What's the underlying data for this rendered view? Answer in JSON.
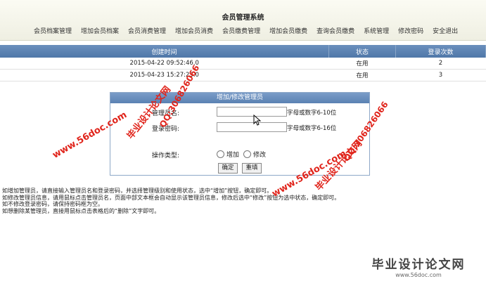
{
  "app": {
    "title": "会员管理系统"
  },
  "nav": [
    "会员档案管理",
    "增加会员档案",
    "会员消费管理",
    "增加会员消费",
    "会员缴费管理",
    "增加会员缴费",
    "查询会员缴费",
    "系统管理",
    "修改密码",
    "安全退出"
  ],
  "table": {
    "headers": [
      "创建时间",
      "状态",
      "登录次数"
    ],
    "rows": [
      [
        "2015-04-22 09:52:46.0",
        "在用",
        "2"
      ],
      [
        "2015-04-23 15:27:23.0",
        "在用",
        "3"
      ]
    ]
  },
  "form": {
    "title": "增加/修改管理员",
    "username_label": "管理员名:",
    "username_value": "",
    "username_hint": "字母或数字6-10位",
    "password_label": "登录密码:",
    "password_value": "",
    "password_hint": "字母或数字6-16位",
    "op_label": "操作类型:",
    "op_add": "增加",
    "op_edit": "修改",
    "submit": "确定",
    "reset": "重填"
  },
  "help": [
    "如增加管理员，请直接输入管理员名和登录密码，并选择管理级别和使用状态，选中“增加”按钮，确定即可。",
    "如修改管理员信息，请用鼠标点击管理员名，页面中部文本框会自动显示该管理员信息，修改后选中“修改”按钮为选中状态，确定即可。",
    "如不修改登录密码，请保持密码框为空。",
    "如想删除某管理员，直接用鼠标点击表格后的“删除”文字即可。"
  ],
  "watermarks": {
    "site": "www.56doc.com",
    "qq": "QQ:306826066",
    "brand": "毕业设计论文网",
    "footer_site": "www.56doc.com"
  },
  "colors": {
    "header_blue": "#5b82b3",
    "watermark_red": "#e0241b"
  }
}
